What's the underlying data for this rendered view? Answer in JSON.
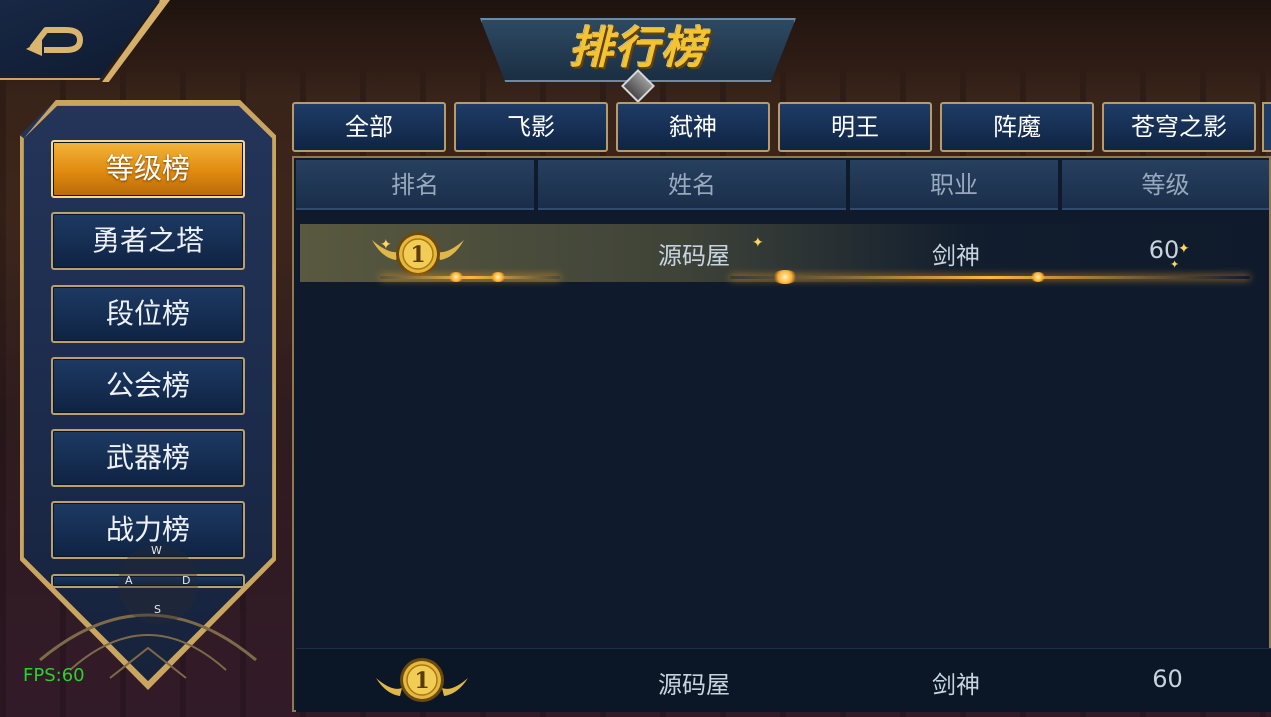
{
  "title": "排行榜",
  "back_button": {
    "icon": "back-arrow-icon"
  },
  "sidebar": {
    "items": [
      {
        "label": "等级榜",
        "active": true
      },
      {
        "label": "勇者之塔",
        "active": false
      },
      {
        "label": "段位榜",
        "active": false
      },
      {
        "label": "公会榜",
        "active": false
      },
      {
        "label": "武器榜",
        "active": false
      },
      {
        "label": "战力榜",
        "active": false
      }
    ]
  },
  "tabs": [
    "全部",
    "飞影",
    "弑神",
    "明王",
    "阵魔",
    "苍穹之影"
  ],
  "table": {
    "headers": [
      "排名",
      "姓名",
      "职业",
      "等级"
    ],
    "rows": [
      {
        "rank": "1",
        "name": "源码屋",
        "class": "剑神",
        "level": "60"
      }
    ],
    "self": {
      "rank": "1",
      "name": "源码屋",
      "class": "剑神",
      "level": "60"
    }
  },
  "joystick": {
    "up": "W",
    "left": "A",
    "right": "D",
    "down": "S"
  },
  "fps": "FPS:60",
  "colors": {
    "accent_gold": "#f3c431",
    "active_tab": "#e08a10",
    "panel_bg": "#0f1b2c",
    "fps_green": "#2ed02e"
  }
}
